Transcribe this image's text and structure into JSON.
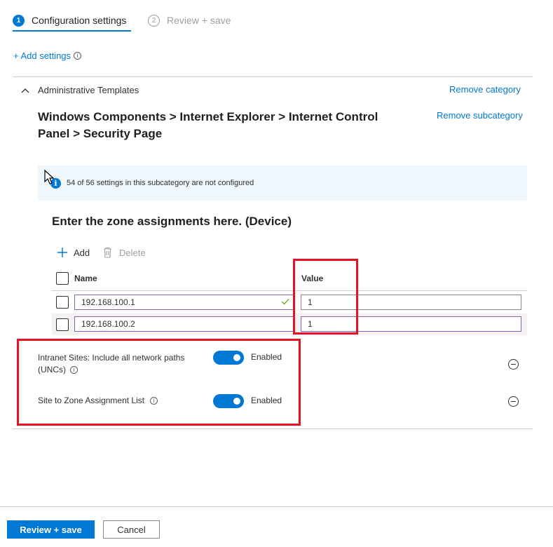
{
  "wizard": {
    "steps": [
      {
        "number": "1",
        "label": "Configuration settings"
      },
      {
        "number": "2",
        "label": "Review + save"
      }
    ]
  },
  "add_settings": {
    "label": "+ Add settings",
    "info_icon": "info-icon"
  },
  "category": {
    "name": "Administrative Templates",
    "remove_category": "Remove category",
    "remove_subcategory": "Remove subcategory",
    "subcategory_title_line1": "Windows Components > Internet Explorer > Internet Control",
    "subcategory_title_line2": "Panel > Security Page"
  },
  "banner": {
    "text": "54 of 56 settings in this subcategory are not configured"
  },
  "zone_assignments": {
    "heading": "Enter the zone assignments here. (Device)",
    "add_label": "Add",
    "delete_label": "Delete",
    "columns": {
      "name": "Name",
      "value": "Value"
    },
    "rows": [
      {
        "name": "192.168.100.1",
        "value": "1"
      },
      {
        "name": "192.168.100.2",
        "value": "1"
      }
    ]
  },
  "settings": [
    {
      "label_line1": "Intranet Sites: Include all network paths",
      "label_line2": "(UNCs)",
      "state": "Enabled"
    },
    {
      "label_line1": "Site to Zone Assignment List",
      "state": "Enabled"
    }
  ],
  "footer": {
    "review_save": "Review + save",
    "cancel": "Cancel"
  },
  "colors": {
    "accent": "#0078d4",
    "highlight_border": "#e81123",
    "banner_background": "#eff6fc"
  }
}
